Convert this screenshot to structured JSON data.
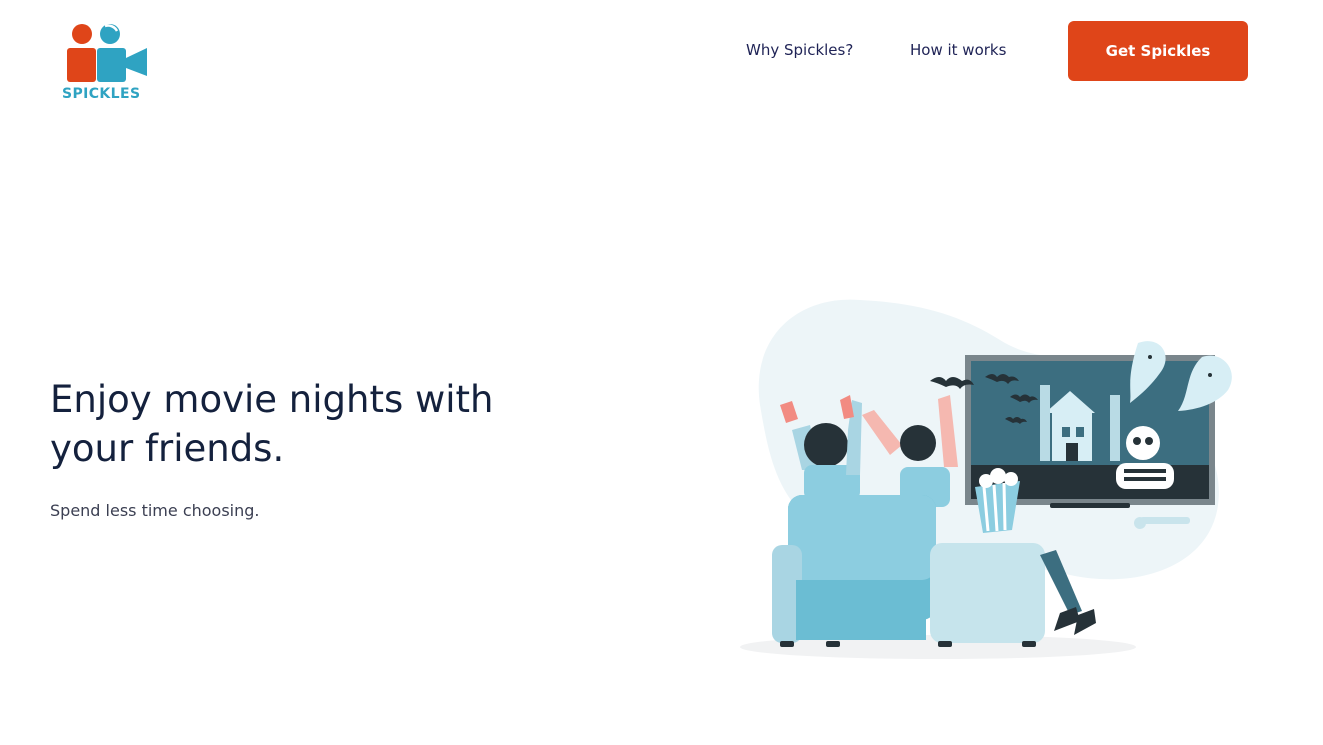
{
  "header": {
    "logo_text": "SPICKLES",
    "nav": [
      {
        "label": "Why Spickles?"
      },
      {
        "label": "How it works"
      }
    ],
    "cta_label": "Get Spickles"
  },
  "hero": {
    "title": "Enjoy movie nights with your friends.",
    "subtitle": "Spend less time choosing."
  },
  "colors": {
    "brand_orange": "#df4519",
    "brand_teal": "#2fa3c2",
    "heading_navy": "#14213d",
    "nav_text": "#1f2356"
  },
  "icons": {
    "logo": "two-people-video-camera-icon"
  }
}
